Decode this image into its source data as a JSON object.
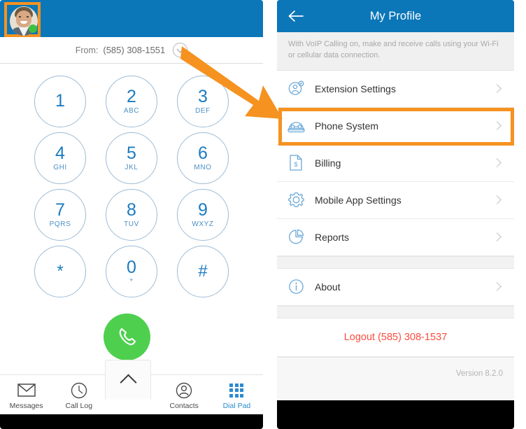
{
  "dialer": {
    "avatar_alt": "user-avatar-photo",
    "presence": "online",
    "from_label": "From:",
    "from_number": "(585) 308-1551",
    "dropdown_icon": "chevron-down-circle-icon",
    "keys": [
      {
        "digit": "1",
        "letters": ""
      },
      {
        "digit": "2",
        "letters": "ABC"
      },
      {
        "digit": "3",
        "letters": "DEF"
      },
      {
        "digit": "4",
        "letters": "GHI"
      },
      {
        "digit": "5",
        "letters": "JKL"
      },
      {
        "digit": "6",
        "letters": "MNO"
      },
      {
        "digit": "7",
        "letters": "PQRS"
      },
      {
        "digit": "8",
        "letters": "TUV"
      },
      {
        "digit": "9",
        "letters": "WXYZ"
      },
      {
        "digit": "*",
        "letters": ""
      },
      {
        "digit": "0",
        "letters": "+"
      },
      {
        "digit": "#",
        "letters": ""
      }
    ],
    "call_button_icon": "phone-handset-icon",
    "call_button_color": "#4ed04e",
    "tabs": [
      {
        "label": "Messages",
        "icon": "envelope-icon",
        "active": false
      },
      {
        "label": "Call Log",
        "icon": "clock-icon",
        "active": false
      },
      {
        "label": "",
        "icon": "chevron-up-icon",
        "active": false
      },
      {
        "label": "Contacts",
        "icon": "person-circle-icon",
        "active": false
      },
      {
        "label": "Dial Pad",
        "icon": "dialpad-grid-icon",
        "active": true
      }
    ]
  },
  "profile": {
    "back_icon": "back-arrow-icon",
    "title": "My Profile",
    "voip_note": "With VoIP Calling on, make and receive calls using your Wi-Fi or cellular data connection.",
    "menu": [
      {
        "label": "Extension Settings",
        "icon": "person-gear-icon",
        "chevron": "chevron-right-icon"
      },
      {
        "label": "Phone System",
        "icon": "desk-phone-icon",
        "chevron": "chevron-right-icon"
      },
      {
        "label": "Billing",
        "icon": "invoice-dollar-icon",
        "chevron": "chevron-right-icon"
      },
      {
        "label": "Mobile App Settings",
        "icon": "gear-icon",
        "chevron": "chevron-right-icon"
      },
      {
        "label": "Reports",
        "icon": "pie-chart-icon",
        "chevron": "chevron-right-icon"
      },
      {
        "label": "About",
        "icon": "info-circle-icon",
        "chevron": "chevron-right-icon"
      }
    ],
    "logout_label": "Logout (585) 308-1537",
    "logout_color": "#fb4d3f",
    "version_label": "Version 8.2.0"
  },
  "annotations": {
    "highlight_color": "#f59220",
    "arrow_icon": "orange-pointer-arrow",
    "avatar_highlight": "avatar-highlight-box",
    "row_highlight": "phone-system-highlight-box"
  },
  "theme": {
    "header_blue": "#0b76b8",
    "accent_blue": "#1c7bc0",
    "screen_bg": "#f7f7f7"
  }
}
